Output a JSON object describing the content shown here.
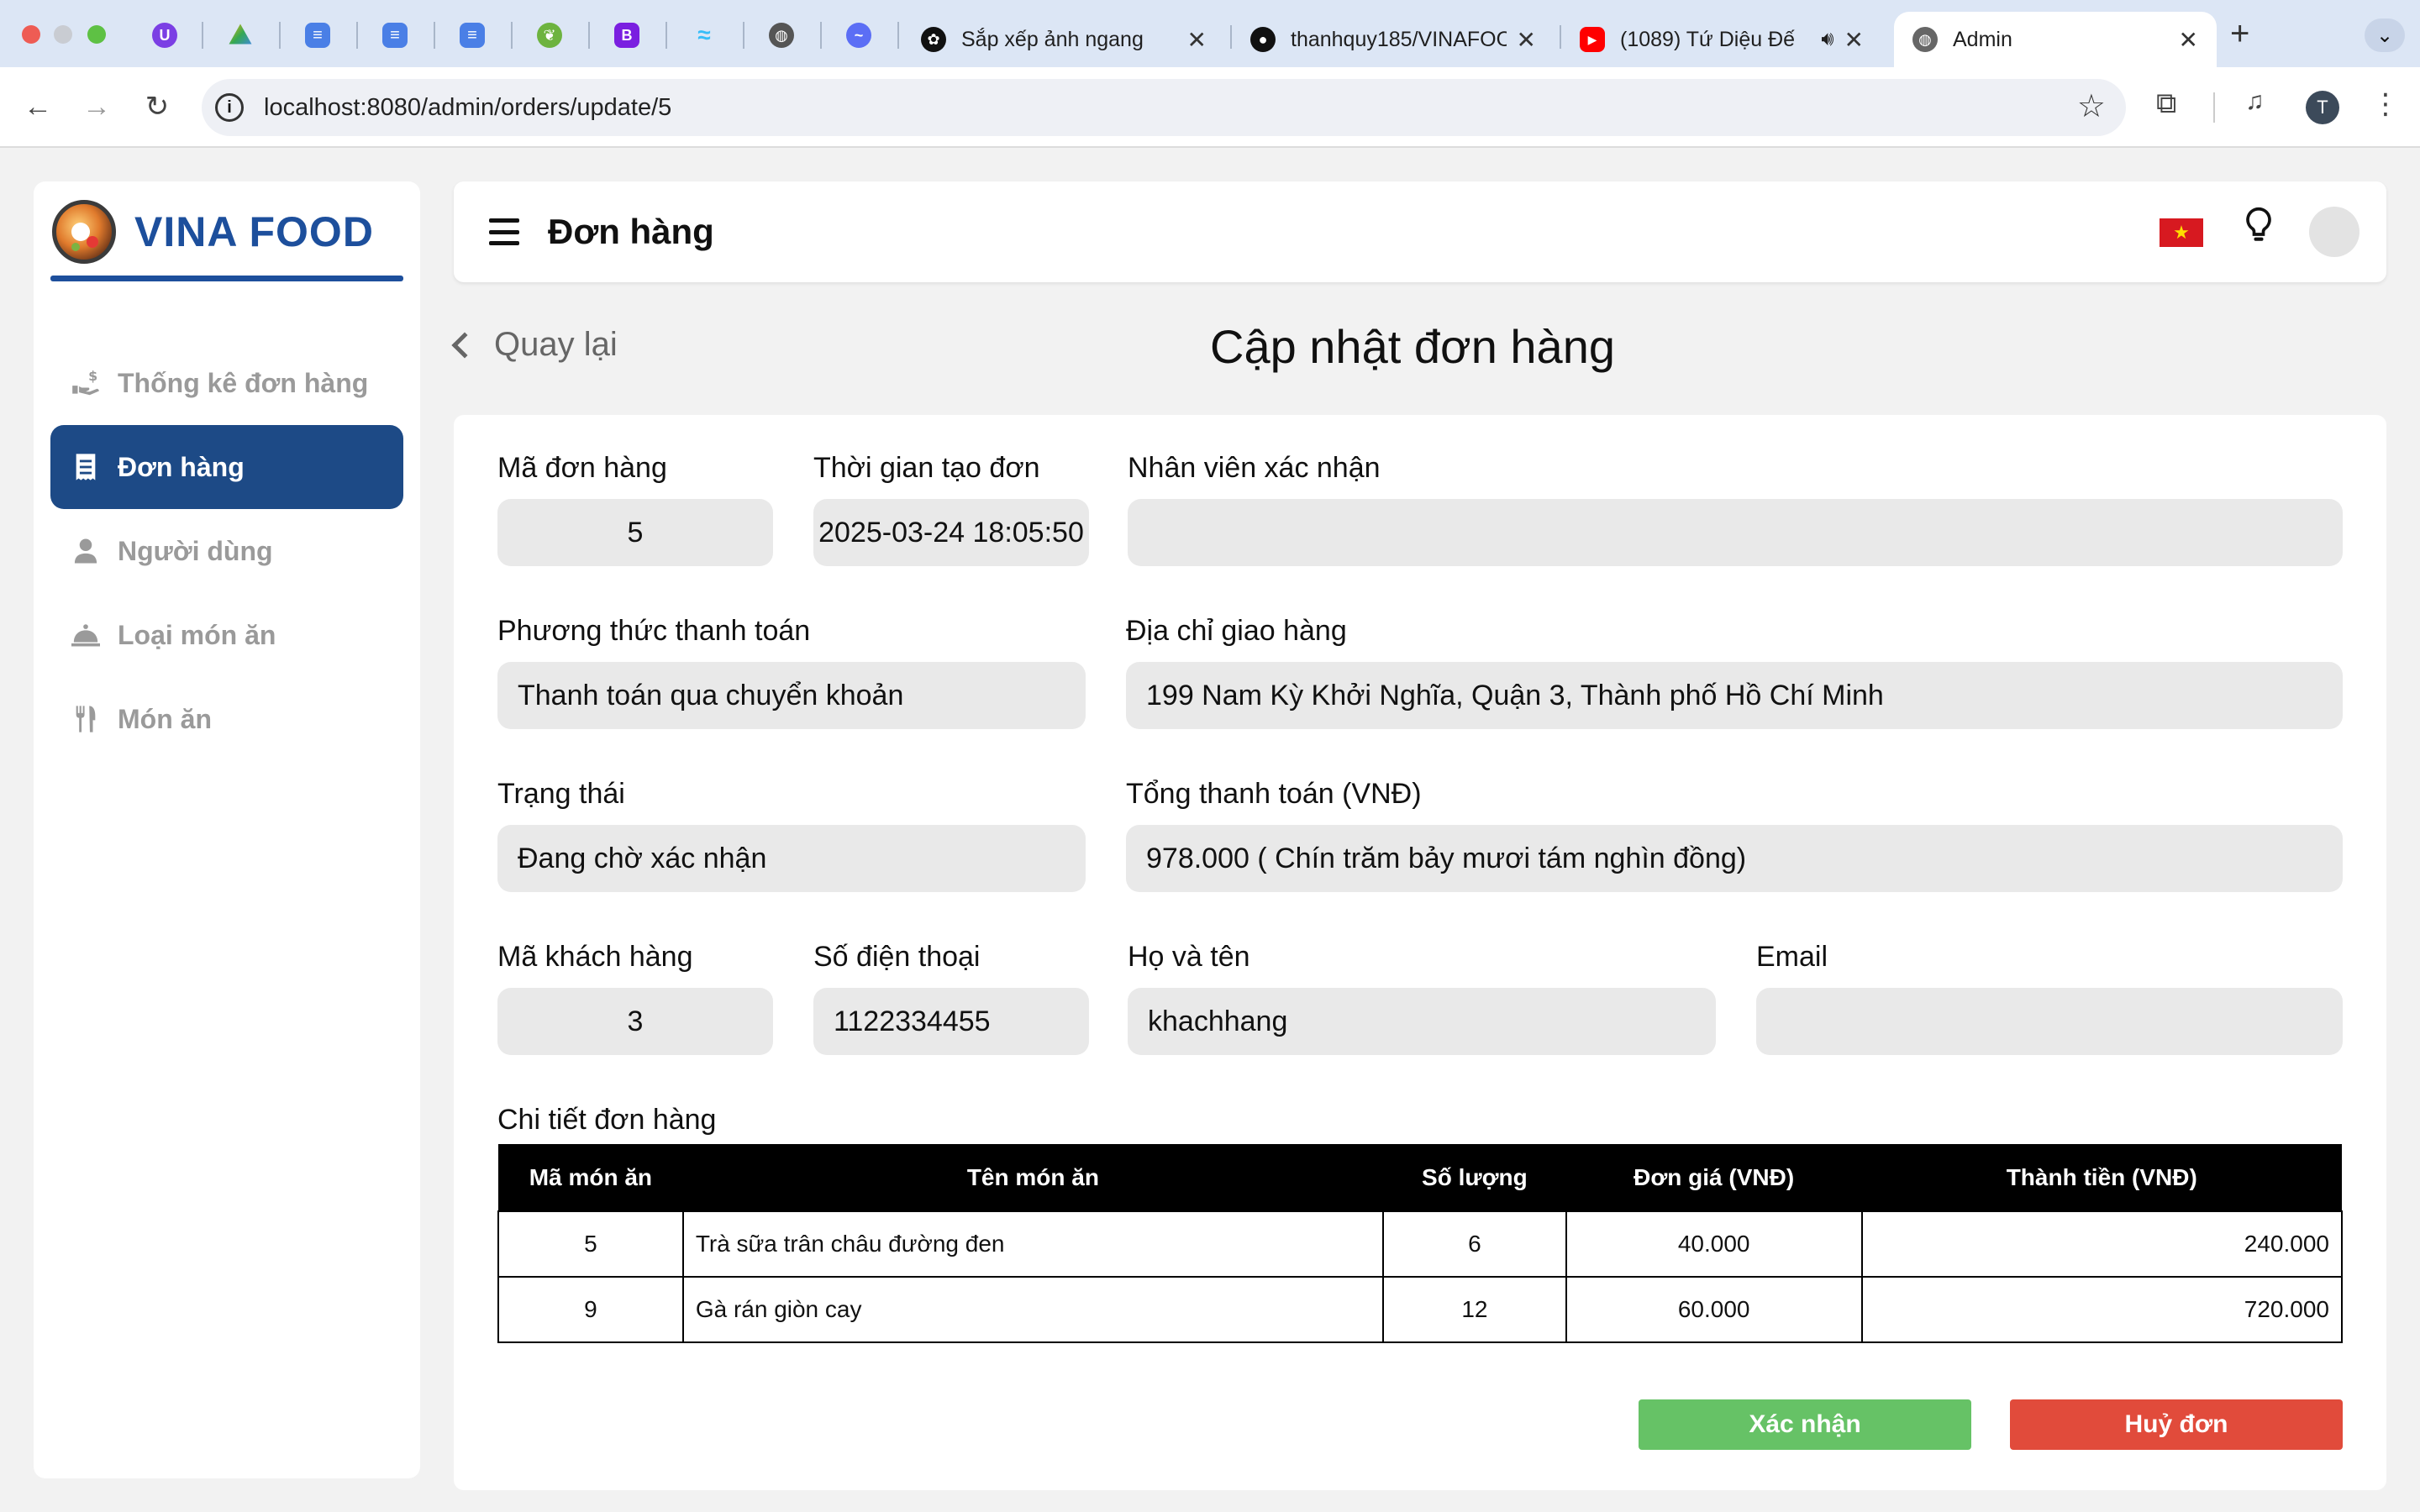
{
  "browser": {
    "tabs": [
      {
        "title": "Sắp xếp ảnh ngang",
        "close": "✕"
      },
      {
        "title": "thanhquy185/VINAFOOD",
        "close": "✕"
      },
      {
        "title": "(1089) Tứ Diệu Đế",
        "close": "✕"
      },
      {
        "title": "Admin",
        "close": "✕"
      }
    ],
    "new_tab": "+",
    "url": "localhost:8080/admin/orders/update/5",
    "profile_initial": "T"
  },
  "app": {
    "brand": "VINA FOOD",
    "brand_color": "#1d4f9c",
    "menu": [
      {
        "label": "Thống kê đơn hàng",
        "icon": "hand-coin-icon"
      },
      {
        "label": "Đơn hàng",
        "icon": "receipt-icon",
        "active": true
      },
      {
        "label": "Người dùng",
        "icon": "user-icon"
      },
      {
        "label": "Loại món ăn",
        "icon": "cloche-icon"
      },
      {
        "label": "Món ăn",
        "icon": "utensils-icon"
      }
    ],
    "topbar_title": "Đơn hàng",
    "back_label": "Quay lại",
    "page_title": "Cập nhật đơn hàng"
  },
  "form": {
    "order_id": {
      "label": "Mã đơn hàng",
      "value": "5"
    },
    "created_at": {
      "label": "Thời gian tạo đơn",
      "value": "2025-03-24 18:05:50"
    },
    "staff": {
      "label": "Nhân viên xác nhận",
      "value": ""
    },
    "payment": {
      "label": "Phương thức thanh toán",
      "value": "Thanh toán qua chuyển khoản"
    },
    "address": {
      "label": "Địa chỉ giao hàng",
      "value": "199 Nam Kỳ Khởi Nghĩa, Quận 3, Thành phố Hồ Chí Minh"
    },
    "status": {
      "label": "Trạng thái",
      "value": "Đang chờ xác nhận"
    },
    "total": {
      "label": "Tổng thanh toán (VNĐ)",
      "value": "978.000 ( Chín trăm bảy mươi tám nghìn đồng)"
    },
    "customer_id": {
      "label": "Mã khách hàng",
      "value": "3"
    },
    "phone": {
      "label": "Số điện thoại",
      "value": "1122334455"
    },
    "fullname": {
      "label": "Họ và tên",
      "value": "khachhang"
    },
    "email": {
      "label": "Email",
      "value": ""
    }
  },
  "details": {
    "label": "Chi tiết đơn hàng",
    "columns": [
      "Mã món ăn",
      "Tên món ăn",
      "Số lượng",
      "Đơn giá (VNĐ)",
      "Thành tiền (VNĐ)"
    ],
    "rows": [
      [
        "5",
        "Trà sữa trân châu đường đen",
        "6",
        "40.000",
        "240.000"
      ],
      [
        "9",
        "Gà rán giòn cay",
        "12",
        "60.000",
        "720.000"
      ]
    ]
  },
  "actions": {
    "confirm": "Xác nhận",
    "cancel": "Huỷ đơn",
    "confirm_color": "#66c266",
    "cancel_color": "#e14b3b"
  }
}
